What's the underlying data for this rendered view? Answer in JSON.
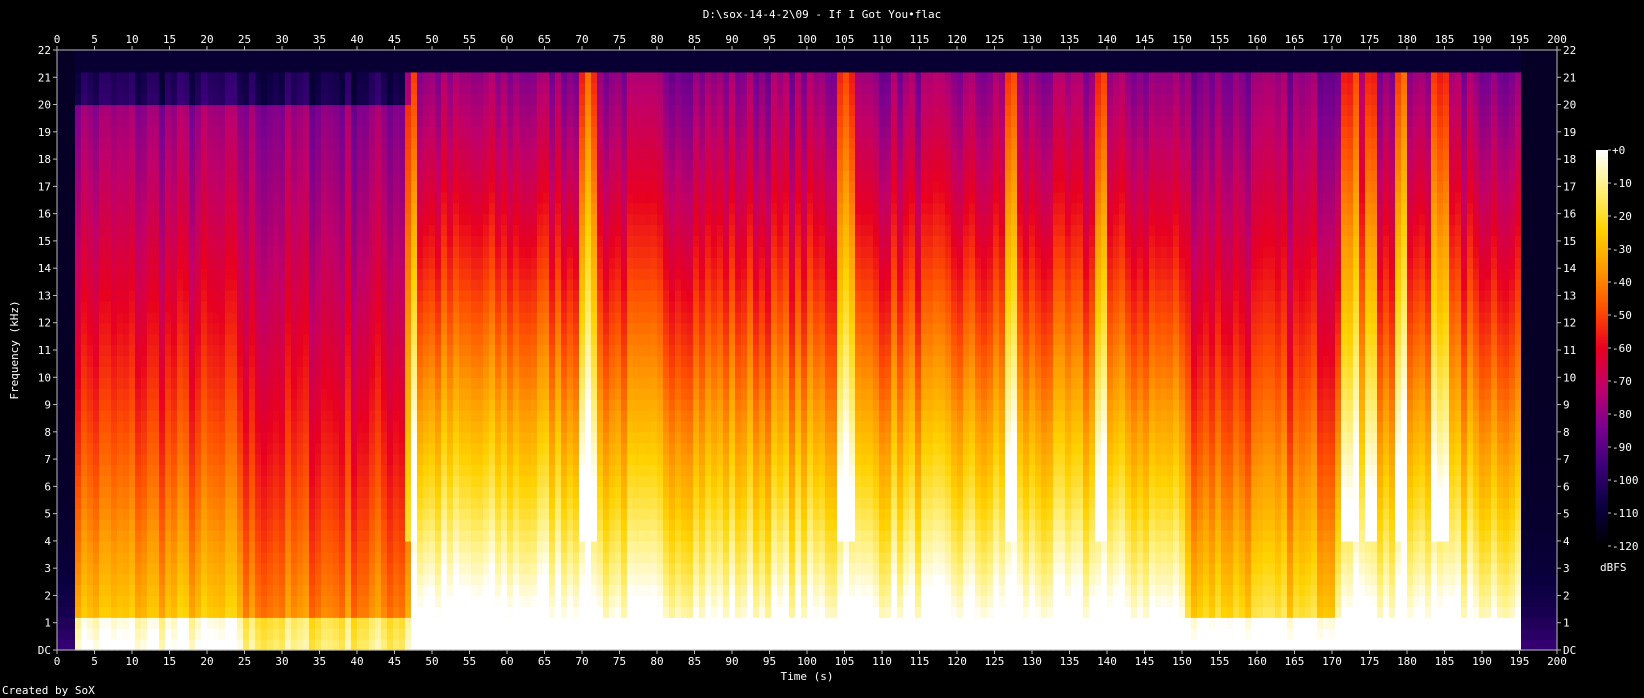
{
  "chart_data": {
    "type": "heatmap",
    "title": "D:\\sox-14-4-2\\09 - If I Got You•flac",
    "xlabel": "Time (s)",
    "ylabel": "Frequency (kHz)",
    "xlim": [
      0,
      200
    ],
    "ylim": [
      0,
      22
    ],
    "x_ticks": [
      "0",
      "5",
      "10",
      "15",
      "20",
      "25",
      "30",
      "35",
      "40",
      "45",
      "50",
      "55",
      "60",
      "65",
      "70",
      "75",
      "80",
      "85",
      "90",
      "95",
      "100",
      "105",
      "110",
      "115",
      "120",
      "125",
      "130",
      "135",
      "140",
      "145",
      "150",
      "155",
      "160",
      "165",
      "170",
      "175",
      "180",
      "185",
      "190",
      "195",
      "200"
    ],
    "y_ticks": [
      "DC",
      "1",
      "2",
      "3",
      "4",
      "5",
      "6",
      "7",
      "8",
      "9",
      "10",
      "11",
      "12",
      "13",
      "14",
      "15",
      "16",
      "17",
      "18",
      "19",
      "20",
      "21",
      "22"
    ],
    "colorbar": {
      "label": "dBFS",
      "range": [
        -120,
        0
      ],
      "ticks": [
        "+0",
        "-10",
        "-20",
        "-30",
        "-40",
        "-50",
        "-60",
        "-70",
        "-80",
        "-90",
        "-100",
        "-110",
        "-120"
      ],
      "colors": [
        "#000000",
        "#0a0040",
        "#3a0078",
        "#7a0090",
        "#c0006a",
        "#e80020",
        "#ff5000",
        "#ff9a00",
        "#ffd200",
        "#fff07a",
        "#ffffff"
      ]
    },
    "sections": [
      {
        "t_start": 0,
        "t_end": 2.3,
        "level": 0.0
      },
      {
        "t_start": 2.3,
        "t_end": 25,
        "level": 0.55
      },
      {
        "t_start": 25,
        "t_end": 47,
        "level": 0.45
      },
      {
        "t_start": 47,
        "t_end": 70.5,
        "level": 0.85
      },
      {
        "t_start": 70.5,
        "t_end": 105,
        "level": 0.8
      },
      {
        "t_start": 105,
        "t_end": 150.5,
        "level": 0.82
      },
      {
        "t_start": 150.5,
        "t_end": 170.5,
        "level": 0.62
      },
      {
        "t_start": 170.5,
        "t_end": 195,
        "level": 0.8
      },
      {
        "t_start": 195,
        "t_end": 200,
        "level": 0.0
      }
    ],
    "bright_transients_s": [
      47.5,
      70.8,
      105.2,
      127,
      139.5,
      172.5,
      175.5,
      179,
      184.5
    ]
  },
  "footer": {
    "credit": "Created by SoX"
  }
}
